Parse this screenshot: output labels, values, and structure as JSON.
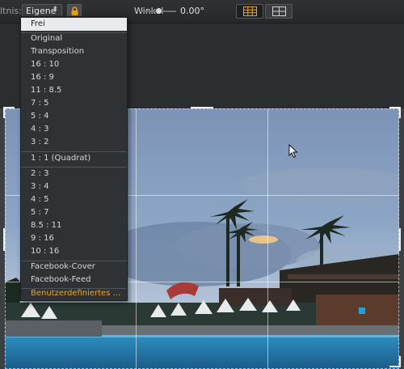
{
  "toolbar": {
    "ratio_label": "ltnis:",
    "ratio_value": "Eigene",
    "angle_label": "Winkel",
    "angle_value": "0.00°"
  },
  "menu": {
    "items": [
      "Frei",
      "Original",
      "Transposition",
      "16 : 10",
      "16 : 9",
      "11 : 8.5",
      "7 : 5",
      "5 : 4",
      "4 : 3",
      "3 : 2",
      "1 : 1 (Quadrat)",
      "2 : 3",
      "3 : 4",
      "4 : 5",
      "5 : 7",
      "8.5 : 11",
      "9 : 16",
      "10 : 16",
      "Facebook-Cover",
      "Facebook-Feed",
      "Benutzerdefiniertes ..."
    ]
  },
  "colors": {
    "accent": "#e8a623",
    "lock": "#f0a000"
  }
}
